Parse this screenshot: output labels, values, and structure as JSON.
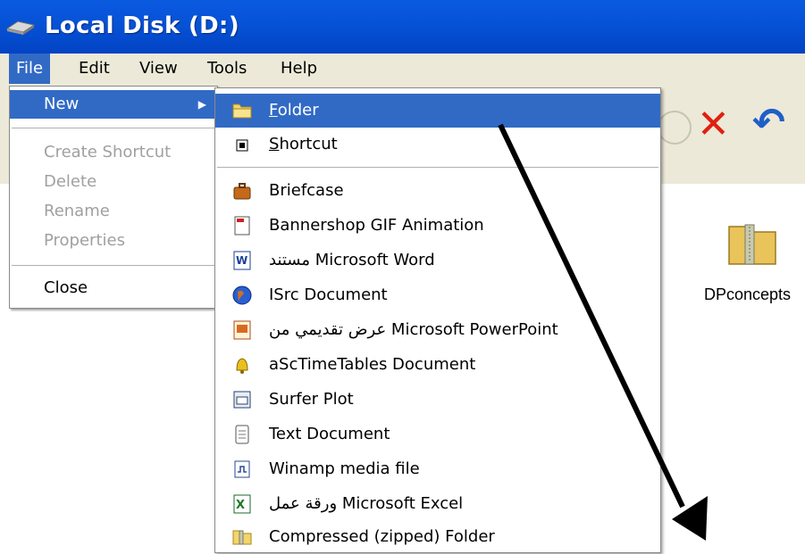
{
  "window": {
    "title": "Local Disk (D:)"
  },
  "menubar": {
    "items": [
      "File",
      "Edit",
      "View",
      "Tools",
      "Help"
    ]
  },
  "file_menu": {
    "new": "New",
    "create_shortcut": "Create Shortcut",
    "delete": "Delete",
    "rename": "Rename",
    "properties": "Properties",
    "close": "Close"
  },
  "new_submenu": {
    "folder_prefix": "",
    "folder_mnemonic": "F",
    "folder_rest": "older",
    "shortcut_mnemonic": "S",
    "shortcut_rest": "hortcut",
    "items": [
      "Briefcase",
      "Bannershop GIF Animation",
      "مستند Microsoft Word",
      "ISrc Document",
      "عرض تقديمي من Microsoft PowerPoint",
      "aScTimeTables Document",
      "Surfer Plot",
      "Text Document",
      "Winamp media file",
      "ورقة عمل Microsoft Excel",
      "Compressed (zipped) Folder"
    ]
  },
  "content": {
    "folder_label": "DPconcepts"
  },
  "icons": {
    "title": "drive-icon",
    "folder": "folder-icon",
    "shortcut": "shortcut-icon",
    "briefcase": "briefcase-icon",
    "delete": "delete-icon",
    "undo": "undo-icon"
  },
  "colors": {
    "titlebar": "#0652d6",
    "highlight": "#316ac5",
    "menu_bg": "#ece9d8",
    "annotation_arrow": "#000000"
  }
}
